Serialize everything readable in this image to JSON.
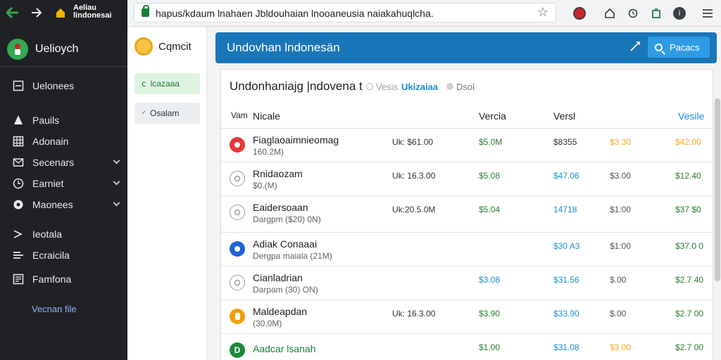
{
  "browser": {
    "url": "hapus/kdaum lnahaen Jbldouhaian lnooaneusia naiakahuqlcha.",
    "top_title_line1": "Aeliau",
    "top_title_line2": "lindonesai"
  },
  "sidebar": {
    "brand": "Uelioych",
    "items": [
      {
        "label": "Uelonees"
      },
      {
        "label": "Pauils"
      },
      {
        "label": "Adonain"
      },
      {
        "label": "Secenars"
      },
      {
        "label": "Earniet"
      },
      {
        "label": "Maonees"
      },
      {
        "label": "Ieotala"
      },
      {
        "label": "Ecraicila"
      },
      {
        "label": "Famfona"
      }
    ],
    "footer": "Vecnan file"
  },
  "column2": {
    "title": "Cqmcit",
    "button1": "lcazaaa",
    "button2": "Osalam"
  },
  "banner": {
    "title": "Undovhan lndonesän",
    "button": "Pacacs"
  },
  "card": {
    "title": "Undonhaniajg |ndovena t",
    "sub1": "Vesis",
    "sub2": "Ukizaiaa",
    "sub3": "Dsol",
    "columns": {
      "c1": "Vam",
      "c2": "Nicale",
      "c3": "Vercia",
      "c4": "Versl",
      "c5": "Vesile"
    }
  },
  "rows": [
    {
      "name": "Fiaglaoaimnieomag",
      "sub": "160.2M)",
      "price": "Uk: $61.00",
      "v1": "$5.0M",
      "v2": "$8355",
      "v3": "$3.30",
      "v4": "$42.00"
    },
    {
      "name": "Rnidaozam",
      "sub": "$0.(M)",
      "price": "Uk: 16.3.00",
      "v1": "$5.08",
      "v2": "$47.06",
      "v3": "$3.00",
      "v4": "$12.40"
    },
    {
      "name": "Eaidersoaan",
      "sub": "Dargpm ($20) 0N)",
      "price": "Uk:20.5.0M",
      "v1": "$5.04",
      "v2": "14718",
      "v3": "$1:00",
      "v4": "$37 $0"
    },
    {
      "name": "Adiak Conaaai",
      "sub": "Dergpa maiala (21M)",
      "price": "",
      "v1": "",
      "v2": "$30 A3",
      "v3": "$1:00",
      "v4": "$37.0 0"
    },
    {
      "name": "Cianladrian",
      "sub": "Darpam (30) ON)",
      "price": "",
      "v1": "$3.08",
      "v2": "$31.56",
      "v3": "$.00",
      "v4": "$2.7 40"
    },
    {
      "name": "Maldeapdan",
      "sub": "(30,0M)",
      "price": "Uk: 16.3.00",
      "v1": "$3.90",
      "v2": "$33.90",
      "v3": "$.00",
      "v4": "$2.7 00"
    },
    {
      "name": "Aadcar lsanah",
      "sub": "",
      "price": "",
      "v1": "$1.00",
      "v2": "$31.08",
      "v3": "$3.00",
      "v4": "$2.7 00"
    }
  ],
  "avatars": [
    "",
    "",
    "",
    "",
    "",
    "",
    "D"
  ]
}
